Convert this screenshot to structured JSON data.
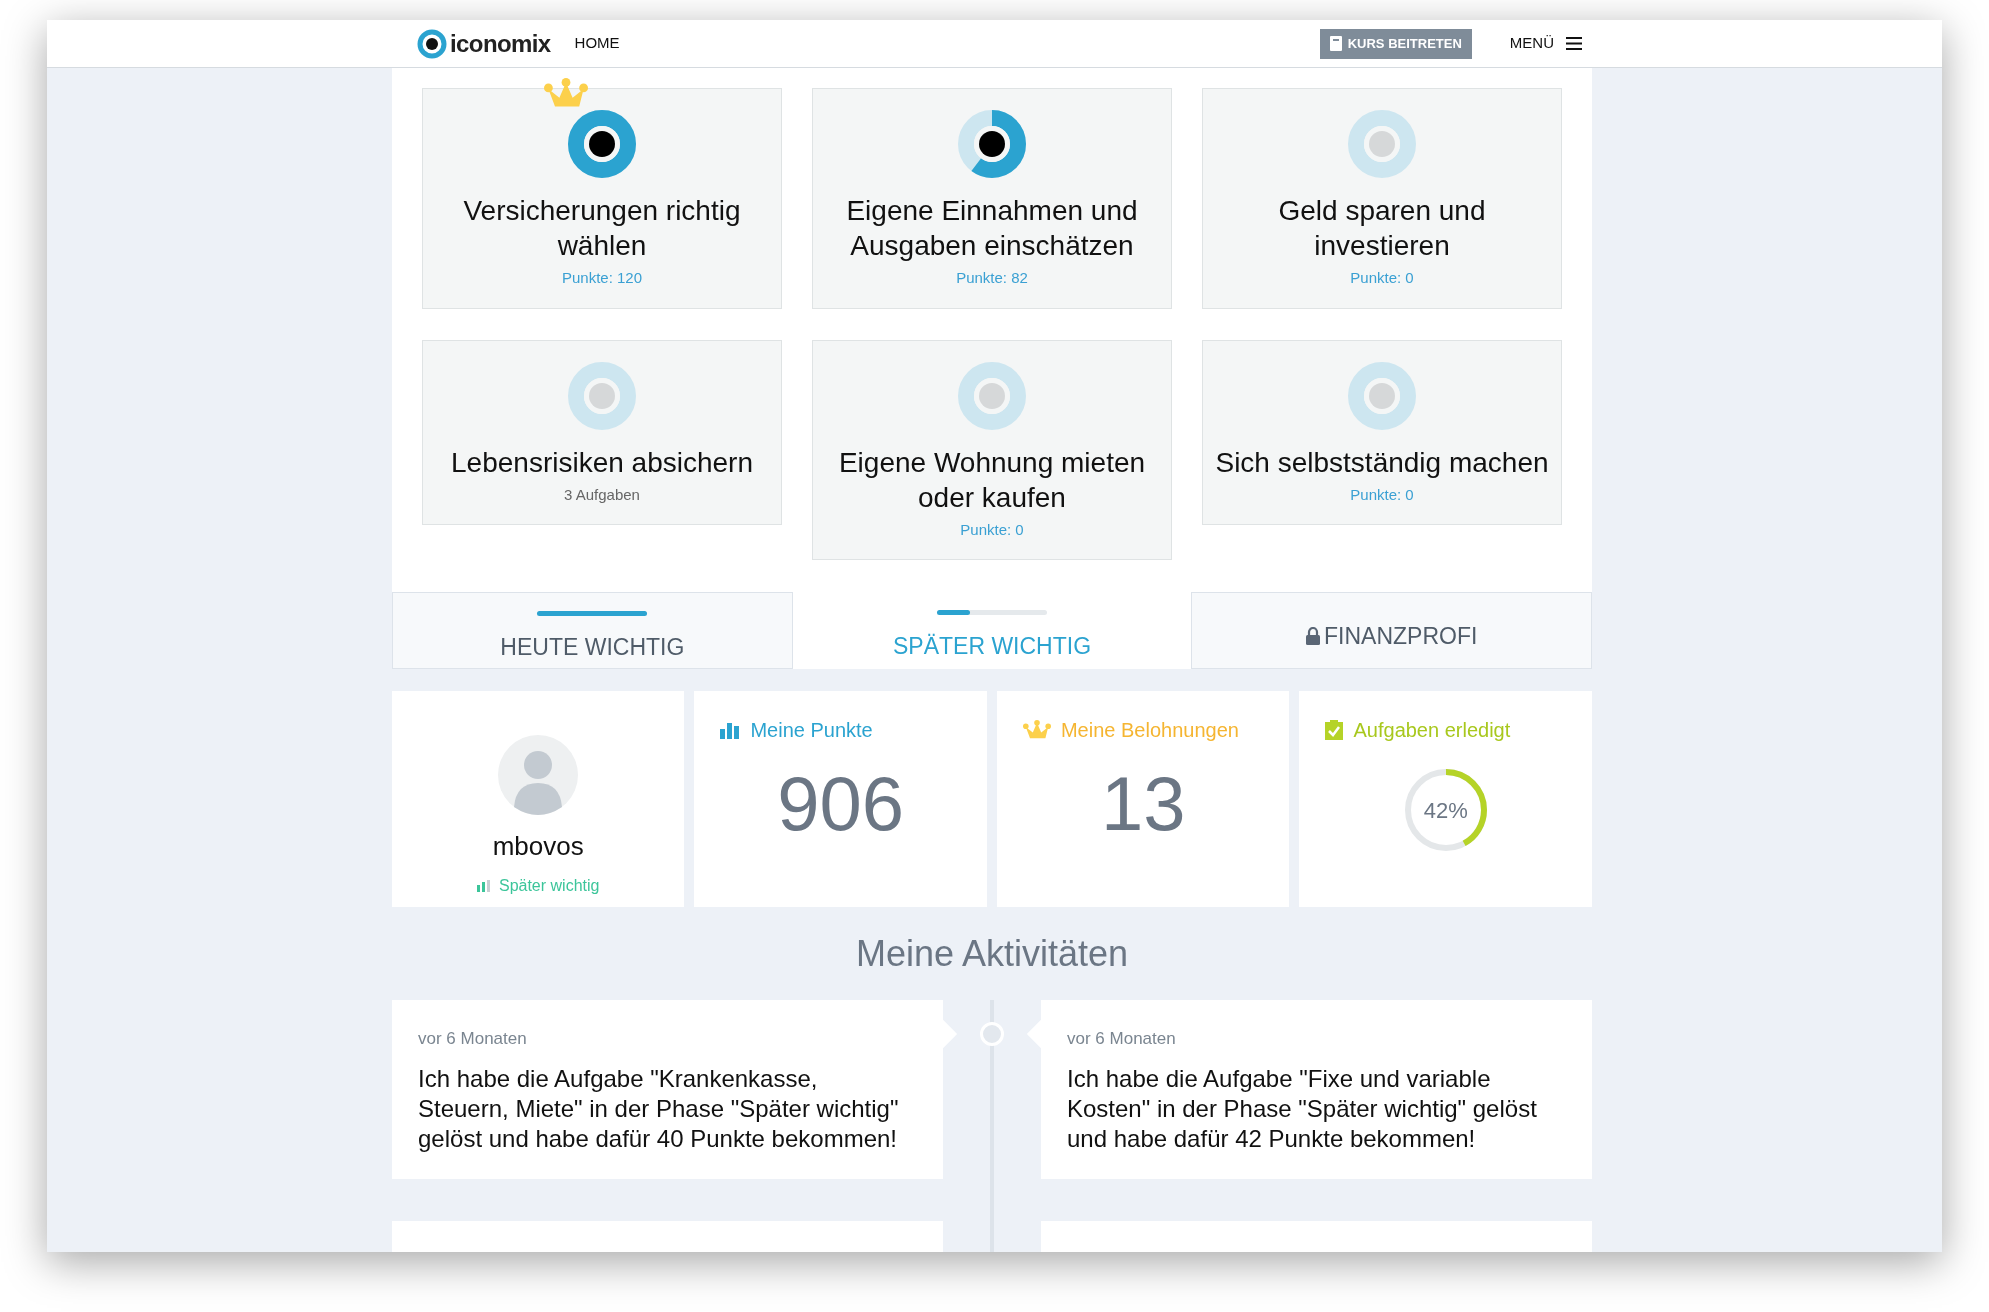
{
  "header": {
    "logo": "iconomix",
    "nav": "HOME",
    "join_button": "KURS BEITRETEN",
    "menu": "MENÜ"
  },
  "courses": [
    {
      "title": "Versicherungen richtig wählen",
      "subtitle": "Punkte: 120",
      "kind": "points",
      "level": 1,
      "crown": true
    },
    {
      "title": "Eigene Einnahmen und Ausgaben einschätzen",
      "subtitle": "Punkte: 82",
      "kind": "points",
      "level": 0.6,
      "crown": false
    },
    {
      "title": "Geld sparen und investieren",
      "subtitle": "Punkte: 0",
      "kind": "points",
      "level": 0,
      "crown": false
    },
    {
      "title": "Lebensrisiken absichern",
      "subtitle": "3 Aufgaben",
      "kind": "tasks",
      "level": 0,
      "crown": false
    },
    {
      "title": "Eigene Wohnung mieten oder kaufen",
      "subtitle": "Punkte: 0",
      "kind": "points",
      "level": 0,
      "crown": false
    },
    {
      "title": "Sich selbstständig machen",
      "subtitle": "Punkte: 0",
      "kind": "points",
      "level": 0,
      "crown": false
    }
  ],
  "tabs": [
    {
      "label": "HEUTE WICHTIG",
      "selected": false,
      "locked": false,
      "level": 1
    },
    {
      "label": "SPÄTER WICHTIG",
      "selected": true,
      "locked": false,
      "level": 0.3
    },
    {
      "label": "FINANZPROFI",
      "selected": false,
      "locked": true
    }
  ],
  "profile": {
    "username": "mbovos",
    "phase": "Später wichtig"
  },
  "stats": [
    {
      "kind": "points",
      "title": "Meine Punkte",
      "value": "906"
    },
    {
      "kind": "rewards",
      "title": "Meine Belohnungen",
      "value": "13"
    },
    {
      "kind": "tasks",
      "title": "Aufgaben erledigt",
      "value": "42%",
      "level": 0.42
    }
  ],
  "activities_title": "Meine Aktivitäten",
  "activities": [
    {
      "time": "vor 6 Monaten",
      "text": "Ich habe die Aufgabe \"Krankenkasse, Steuern, Miete\" in der Phase \"Später wichtig\" gelöst und habe dafür 40 Punkte bekommen!"
    },
    {
      "time": "vor 6 Monaten",
      "text": "Ich habe die Aufgabe \"Fixe und variable Kosten\" in der Phase \"Später wichtig\" gelöst und habe dafür 42 Punkte bekommen!"
    }
  ]
}
